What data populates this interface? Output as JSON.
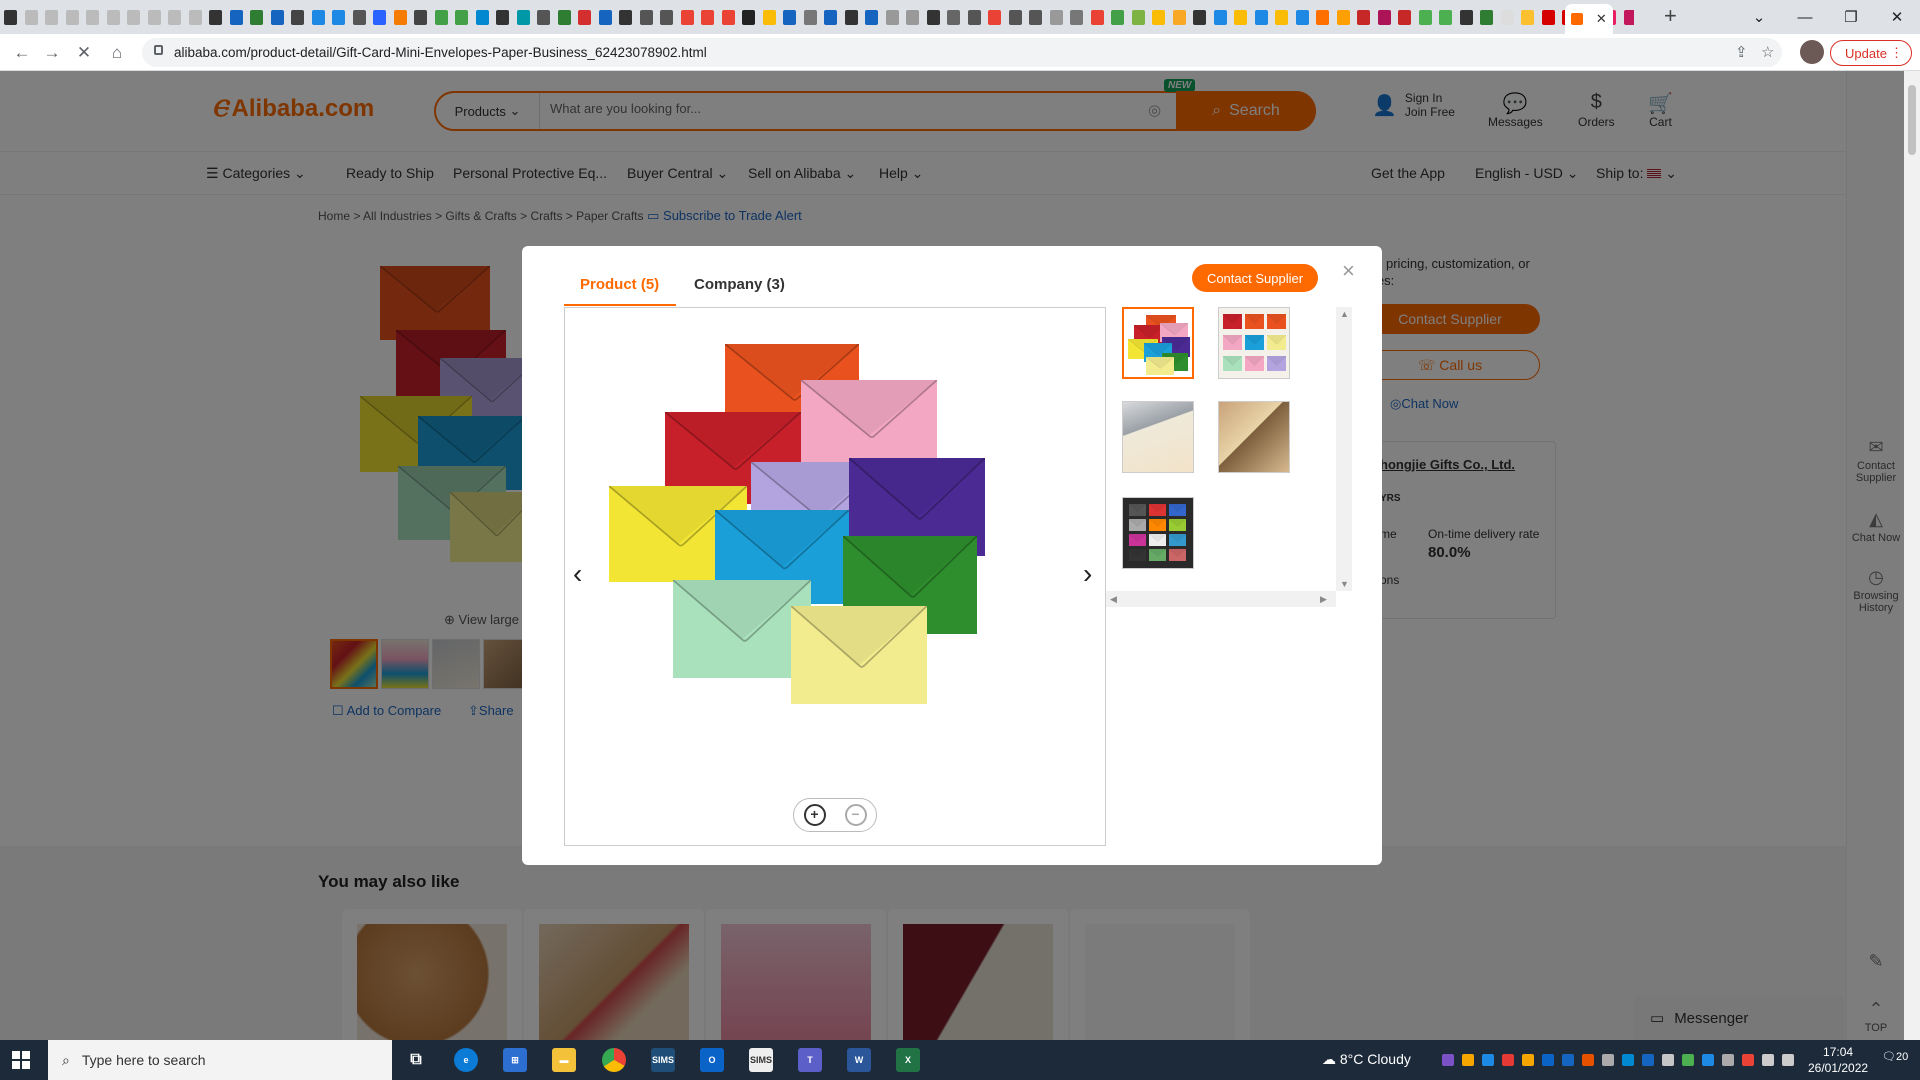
{
  "browser": {
    "url": "alibaba.com/product-detail/Gift-Card-Mini-Envelopes-Paper-Business_62423078902.html",
    "update_label": "Update",
    "tab_close": "✕",
    "new_tab": "+",
    "mini_tab_colors": [
      "#333",
      "#bbb",
      "#bbb",
      "#bbb",
      "#bbb",
      "#bbb",
      "#bbb",
      "#bbb",
      "#bbb",
      "#bbb",
      "#333",
      "#1565c0",
      "#2e7d32",
      "#1565c0",
      "#444",
      "#1e88e5",
      "#1e88e5",
      "#555",
      "#2962ff",
      "#f57c00",
      "#444",
      "#43a047",
      "#43a047",
      "#0288d1",
      "#333",
      "#0097a7",
      "#555",
      "#2e7d32",
      "#d32f2f",
      "#1565c0",
      "#333",
      "#555",
      "#555",
      "#ea4335",
      "#ea4335",
      "#ea4335",
      "#222",
      "#fbbc05",
      "#1565c0",
      "#777",
      "#1565c0",
      "#333",
      "#1565c0",
      "#999",
      "#999",
      "#333",
      "#666",
      "#555",
      "#ea4335",
      "#555",
      "#555",
      "#999",
      "#777",
      "#ea4335",
      "#43a047",
      "#7cb342",
      "#fbbc05",
      "#f9a825",
      "#333",
      "#1e88e5",
      "#fbbc05",
      "#1e88e5",
      "#fbbc05",
      "#1e88e5",
      "#ff6f00",
      "#ffa000",
      "#c62828",
      "#ad1457",
      "#c62828",
      "#4caf50",
      "#4caf50",
      "#333",
      "#2e7d32",
      "#ddd",
      "#fbc02d",
      "#d50000",
      "#d50000",
      "#1565c0",
      "#e91e63",
      "#c2185b"
    ]
  },
  "site": {
    "logo_text": "Alibaba.com",
    "search": {
      "category": "Products",
      "placeholder": "What are you looking for...",
      "button": "Search",
      "badge": "NEW"
    },
    "header_actions": {
      "signin_line1": "Sign In",
      "signin_line2": "Join Free",
      "messages": "Messages",
      "orders": "Orders",
      "cart": "Cart"
    },
    "nav": {
      "categories": "Categories",
      "ready_to_ship": "Ready to Ship",
      "ppe": "Personal Protective Eq...",
      "buyer_central": "Buyer Central",
      "sell_on_alibaba": "Sell on Alibaba",
      "help": "Help",
      "get_app": "Get the App",
      "language": "English - USD",
      "ship_to": "Ship to:"
    },
    "breadcrumb": [
      "Home",
      "All Industries",
      "Gifts & Crafts",
      "Crafts",
      "Paper Crafts"
    ],
    "subscribe_alert": "Subscribe to Trade Alert",
    "view_larger": "View large",
    "add_to_compare": "Add to Compare",
    "share": "Share",
    "right_col": {
      "pricing_line1": "pricing, customization, or",
      "pricing_line2": "ies:",
      "contact_supplier": "Contact Supplier",
      "call_us": "Call us",
      "chat_now": "Chat Now",
      "company": "hongjie Gifts Co., Ltd.",
      "yrs": "YRS",
      "me": "me",
      "ontime_label": "On-time delivery rate",
      "ontime_value": "80.0%",
      "ons": "ons"
    },
    "rail": {
      "contact_line1": "Contact",
      "contact_line2": "Supplier",
      "chat_now": "Chat Now",
      "browsing_line1": "Browsing",
      "browsing_line2": "History",
      "top": "TOP"
    },
    "also_like": "You may also like",
    "messenger": "Messenger"
  },
  "modal": {
    "tab_product": "Product (5)",
    "tab_company": "Company (3)",
    "contact_supplier": "Contact Supplier",
    "close": "×",
    "prev": "‹",
    "next": "›",
    "zoom_in": "+",
    "zoom_out": "−"
  },
  "envelope_colors": {
    "orange": "#e9521f",
    "pink": "#f3a7c3",
    "red": "#c8202a",
    "lavender": "#b3a4e0",
    "purple": "#4b2a94",
    "yellow": "#f2e533",
    "blue": "#1a9fd9",
    "green": "#2e8e2d",
    "mint": "#a9e1bd",
    "cream": "#f2ec8e"
  },
  "taskbar": {
    "search_placeholder": "Type here to search",
    "weather": "8°C  Cloudy",
    "time": "17:04",
    "date": "26/01/2022",
    "notifications": "20"
  }
}
